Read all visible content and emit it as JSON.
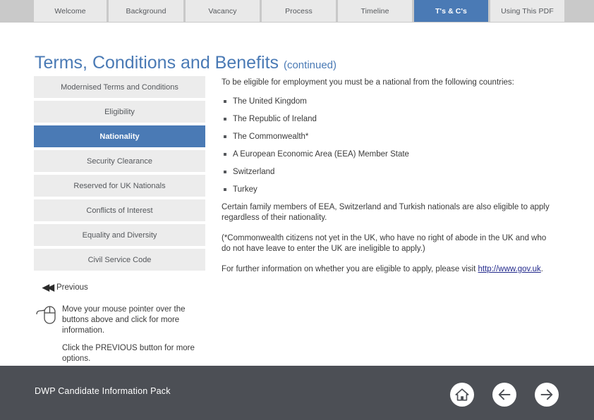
{
  "header": {
    "tabs": [
      {
        "label": "Welcome",
        "active": false
      },
      {
        "label": "Background",
        "active": false
      },
      {
        "label": "Vacancy",
        "active": false
      },
      {
        "label": "Process",
        "active": false
      },
      {
        "label": "Timeline",
        "active": false
      },
      {
        "label": "T's & C's",
        "active": true
      },
      {
        "label": "Using This PDF",
        "active": false
      }
    ]
  },
  "title": {
    "main": "Terms, Conditions and Benefits",
    "suffix": "(continued)"
  },
  "sidenav": {
    "items": [
      {
        "label": "Modernised Terms and Conditions",
        "active": false
      },
      {
        "label": "Eligibility",
        "active": false
      },
      {
        "label": "Nationality",
        "active": true
      },
      {
        "label": "Security Clearance",
        "active": false
      },
      {
        "label": "Reserved for UK Nationals",
        "active": false
      },
      {
        "label": "Conflicts of Interest",
        "active": false
      },
      {
        "label": "Equality and Diversity",
        "active": false
      },
      {
        "label": "Civil Service Code",
        "active": false
      }
    ]
  },
  "previous": {
    "chevrons": "◀◀",
    "label": "Previous"
  },
  "hints": {
    "mouse_hint": "Move your mouse pointer over the buttons above and click for more information.",
    "previous_hint": "Click the PREVIOUS button for more options."
  },
  "content": {
    "lead": "To be eligible for employment you must be a national from the following countries:",
    "bullets": [
      "The United Kingdom",
      "The Republic of Ireland",
      "The Commonwealth*",
      "A European Economic Area (EEA) Member State",
      "Switzerland",
      "Turkey"
    ],
    "para_family": "Certain family members of EEA, Switzerland and Turkish nationals are also eligible to apply regardless of their nationality.",
    "para_footnote": "(*Commonwealth citizens not yet in the UK, who have no right of abode in the UK and who do not have leave to enter the UK are ineligible to apply.)",
    "para_further_prefix": "For further information on whether you are eligible to apply, please visit ",
    "link_text": "http://www.gov.uk",
    "para_further_suffix": "."
  },
  "footer": {
    "title": "DWP Candidate Information Pack",
    "buttons": [
      {
        "name": "home",
        "label": "Home"
      },
      {
        "name": "back",
        "label": "Back"
      },
      {
        "name": "forward",
        "label": "Forward"
      }
    ]
  },
  "colors": {
    "accent_blue": "#4a7ab5",
    "header_band": "#c9c9c9",
    "tab_bg": "#e9e9e9",
    "nav_bg": "#ececec",
    "footer_bg": "#4c4f55",
    "link": "#232a8c",
    "body_text": "#3a3a3a"
  }
}
